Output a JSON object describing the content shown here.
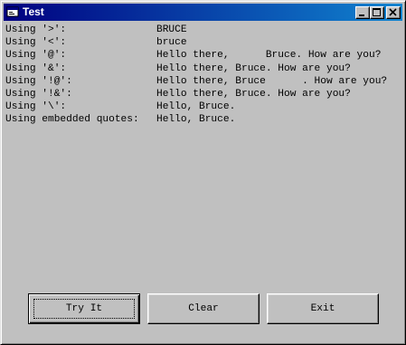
{
  "window": {
    "title": "Test",
    "icon": "app-window-icon",
    "controls": {
      "minimize": "minimize-icon",
      "maximize": "maximize-icon",
      "close": "close-icon"
    }
  },
  "output_lines": [
    {
      "label": "Using '>':",
      "value": "BRUCE"
    },
    {
      "label": "Using '<':",
      "value": "bruce"
    },
    {
      "label": "Using '@':",
      "value": "Hello there,      Bruce. How are you?"
    },
    {
      "label": "Using '&':",
      "value": "Hello there, Bruce. How are you?"
    },
    {
      "label": "Using '!@':",
      "value": "Hello there, Bruce      . How are you?"
    },
    {
      "label": "Using '!&':",
      "value": "Hello there, Bruce. How are you?"
    },
    {
      "label": "Using '\\':",
      "value": "Hello, Bruce."
    },
    {
      "label": "Using embedded quotes:",
      "value": "Hello, Bruce."
    }
  ],
  "buttons": {
    "try_it": "Try It",
    "clear": "Clear",
    "exit": "Exit"
  },
  "colors": {
    "titlebar_start": "#000080",
    "titlebar_end": "#1084d0",
    "face": "#c0c0c0"
  }
}
